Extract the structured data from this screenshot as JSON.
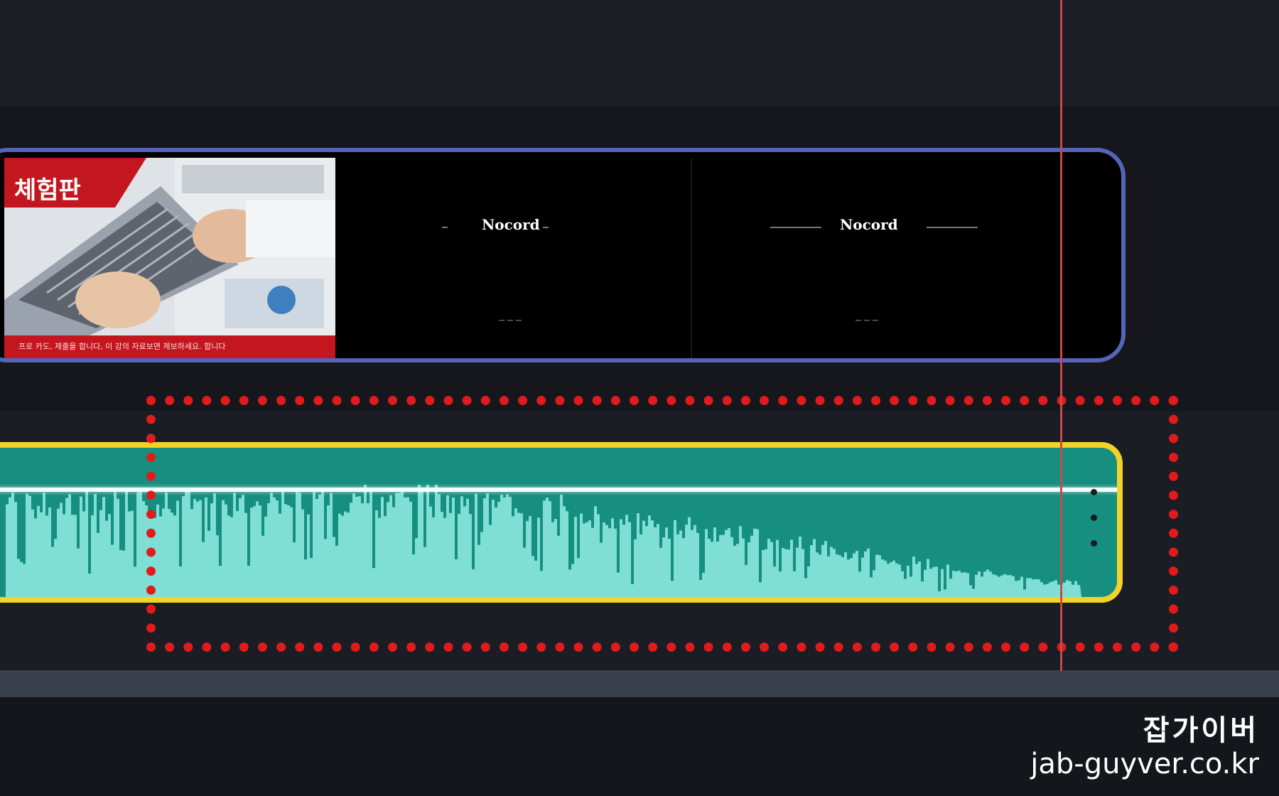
{
  "timeline": {
    "video_clip": {
      "thumbnail_banner": "체험판",
      "thumbnail_caption": "프로 카도, 제출을 합니다, 이 강의 자료보면 제보하세요. 합니다",
      "frame1_title": "Nocord",
      "frame2_title": "Nocord",
      "frame1_small": "— — —",
      "frame2_small": "— — —",
      "accent_color": "#5563b8"
    },
    "audio_clip": {
      "border_color": "#f3d229",
      "fill_color": "#168f80"
    },
    "playhead_color": "#c84a48",
    "highlight_color": "#e11b1b"
  },
  "watermark": {
    "korean": "잡가이버",
    "site": "jab-guyver.co.kr"
  }
}
